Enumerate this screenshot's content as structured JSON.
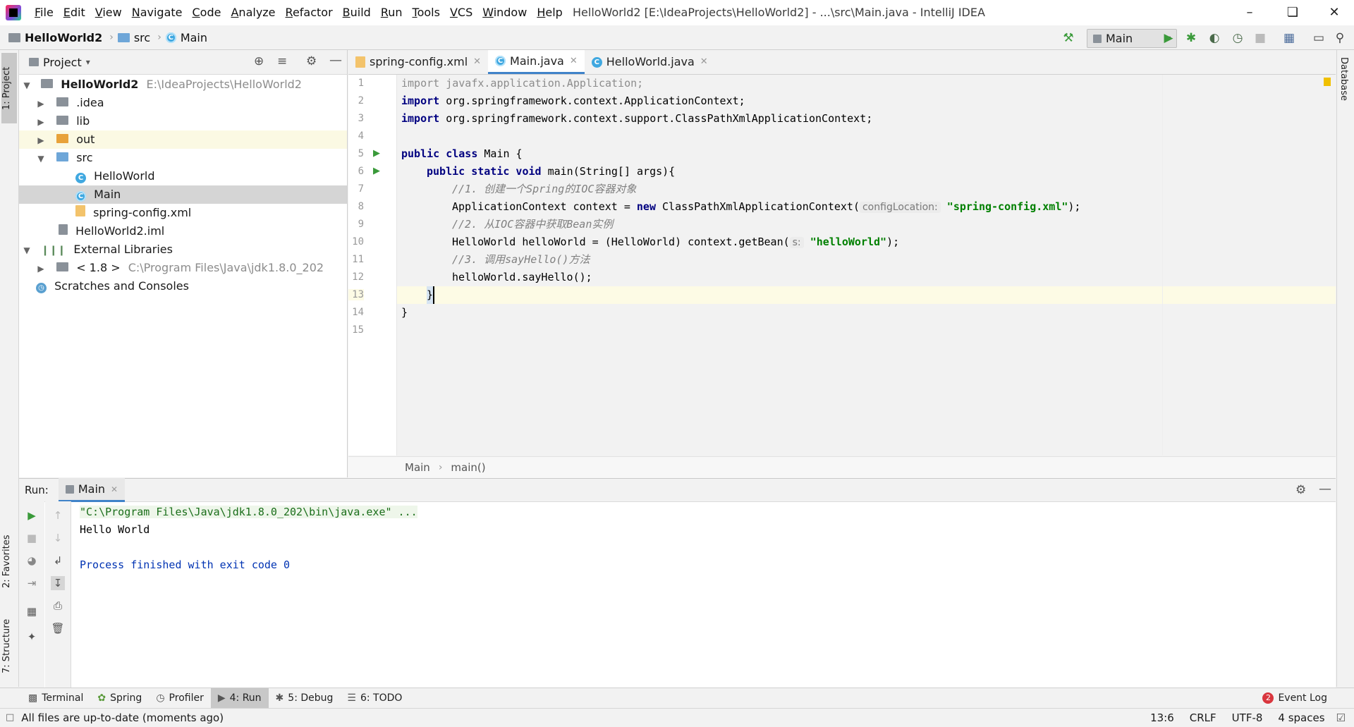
{
  "menu": [
    "File",
    "Edit",
    "View",
    "Navigate",
    "Code",
    "Analyze",
    "Refactor",
    "Build",
    "Run",
    "Tools",
    "VCS",
    "Window",
    "Help"
  ],
  "window_title": "HelloWorld2 [E:\\IdeaProjects\\HelloWorld2] - ...\\src\\Main.java - IntelliJ IDEA",
  "breadcrumb": {
    "project": "HelloWorld2",
    "folder": "src",
    "file": "Main"
  },
  "run_config": "Main",
  "left_strip": {
    "project_tab": "1: Project",
    "favorites_tab": "2: Favorites",
    "structure_tab": "7: Structure"
  },
  "right_strip": {
    "database_tab": "Database"
  },
  "project_panel": {
    "title": "Project",
    "tree": {
      "root_name": "HelloWorld2",
      "root_path": "E:\\IdeaProjects\\HelloWorld2",
      "idea": ".idea",
      "lib": "lib",
      "out": "out",
      "src": "src",
      "helloworld": "HelloWorld",
      "main": "Main",
      "spring_config": "spring-config.xml",
      "iml": "HelloWorld2.iml",
      "external_libraries": "External Libraries",
      "jdk_label": "< 1.8 >",
      "jdk_path": "C:\\Program Files\\Java\\jdk1.8.0_202",
      "scratches": "Scratches and Consoles"
    }
  },
  "editor": {
    "tabs": [
      "spring-config.xml",
      "Main.java",
      "HelloWorld.java"
    ],
    "line_numbers": [
      "1",
      "2",
      "3",
      "4",
      "5",
      "6",
      "7",
      "8",
      "9",
      "10",
      "11",
      "12",
      "13",
      "14",
      "15"
    ],
    "code": {
      "l1_kw": "import",
      "l1_rest": " javafx.application.Application;",
      "l2_kw": "import",
      "l2_rest": " org.springframework.context.ApplicationContext;",
      "l3_kw": "import",
      "l3_rest": " org.springframework.context.support.ClassPathXmlApplicationContext;",
      "l5_kw": "public class",
      "l5_rest": " Main {",
      "l6_kw": "public static void",
      "l6_rest": " main(String[] args){",
      "l7": "//1. 创建一个Spring的IOC容器对象",
      "l8_a": "ApplicationContext context = ",
      "l8_new": "new",
      "l8_b": " ClassPathXmlApplicationContext(",
      "l8_hint": "configLocation:",
      "l8_str": "\"spring-config.xml\"",
      "l8_end": ");",
      "l9": "//2. 从IOC容器中获取Bean实例",
      "l10_a": "HelloWorld helloWorld = (HelloWorld) context.getBean(",
      "l10_hint": "s:",
      "l10_str": "\"helloWorld\"",
      "l10_end": ");",
      "l11": "//3. 调用sayHello()方法",
      "l12": "helloWorld.sayHello();",
      "l13": "}",
      "l14": "}"
    },
    "breadcrumb": {
      "class": "Main",
      "method": "main()"
    }
  },
  "run_panel": {
    "label": "Run:",
    "tab": "Main",
    "console": {
      "cmd": "\"C:\\Program Files\\Java\\jdk1.8.0_202\\bin\\java.exe\" ...",
      "output": "Hello World",
      "exit": "Process finished with exit code 0"
    }
  },
  "bottom_tabs": [
    {
      "label": "Terminal",
      "icon": "terminal-icon"
    },
    {
      "label": "Spring",
      "icon": "spring-icon"
    },
    {
      "label": "Profiler",
      "icon": "profiler-icon"
    },
    {
      "label": "4: Run",
      "icon": "run-icon"
    },
    {
      "label": "5: Debug",
      "icon": "debug-icon"
    },
    {
      "label": "6: TODO",
      "icon": "todo-icon"
    }
  ],
  "event_log": {
    "label": "Event Log",
    "count": "2"
  },
  "status_bar": {
    "message": "All files are up-to-date (moments ago)",
    "position": "13:6",
    "line_sep": "CRLF",
    "encoding": "UTF-8",
    "indent": "4 spaces"
  },
  "colors": {
    "accent": "#4083c9",
    "keyword": "#000080",
    "string": "#008000",
    "comment": "#808080",
    "run_green": "#3a9a3a"
  }
}
